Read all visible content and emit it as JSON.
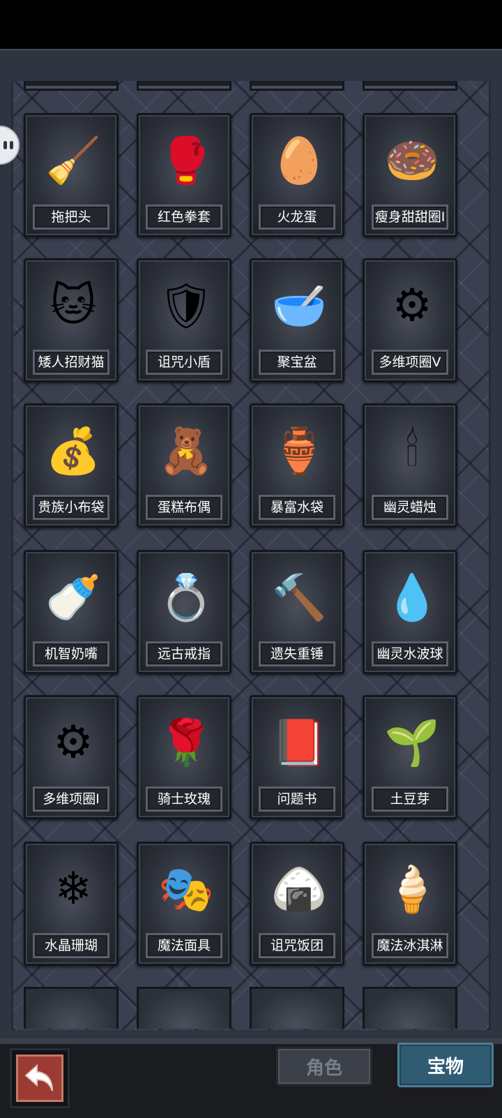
{
  "tabs": [
    {
      "label": "角色",
      "active": false
    },
    {
      "label": "宝物",
      "active": true
    }
  ],
  "items": [
    {
      "name": "拖把头",
      "icon": "mop-head-icon",
      "glyph": "🧹"
    },
    {
      "name": "红色拳套",
      "icon": "red-boxing-glove-icon",
      "glyph": "🥊"
    },
    {
      "name": "火龙蛋",
      "icon": "fire-dragon-egg-icon",
      "glyph": "🥚"
    },
    {
      "name": "瘦身甜甜圈Ⅰ",
      "icon": "donut-icon",
      "glyph": "🍩"
    },
    {
      "name": "矮人招财猫",
      "icon": "lucky-cat-icon",
      "glyph": "🐱"
    },
    {
      "name": "诅咒小盾",
      "icon": "cursed-shield-icon",
      "glyph": "🛡"
    },
    {
      "name": "聚宝盆",
      "icon": "treasure-bowl-icon",
      "glyph": "🥣"
    },
    {
      "name": "多维项圈Ⅴ",
      "icon": "spiked-collar-icon",
      "glyph": "⚙"
    },
    {
      "name": "贵族小布袋",
      "icon": "cloth-pouch-icon",
      "glyph": "💰"
    },
    {
      "name": "蛋糕布偶",
      "icon": "voodoo-doll-icon",
      "glyph": "🧸"
    },
    {
      "name": "暴富水袋",
      "icon": "water-flask-icon",
      "glyph": "🏺"
    },
    {
      "name": "幽灵蜡烛",
      "icon": "ghost-candle-icon",
      "glyph": "🕯"
    },
    {
      "name": "机智奶嘴",
      "icon": "pacifier-icon",
      "glyph": "🍼"
    },
    {
      "name": "远古戒指",
      "icon": "ancient-ring-icon",
      "glyph": "💍"
    },
    {
      "name": "遗失重锤",
      "icon": "lost-hammer-icon",
      "glyph": "🔨"
    },
    {
      "name": "幽灵水波球",
      "icon": "water-orb-icon",
      "glyph": "💧"
    },
    {
      "name": "多维项圈Ⅰ",
      "icon": "spiked-collar-icon",
      "glyph": "⚙"
    },
    {
      "name": "骑士玫瑰",
      "icon": "rose-icon",
      "glyph": "🌹"
    },
    {
      "name": "问题书",
      "icon": "question-book-icon",
      "glyph": "📕"
    },
    {
      "name": "土豆芽",
      "icon": "potato-sprout-icon",
      "glyph": "🌱"
    },
    {
      "name": "水晶珊瑚",
      "icon": "crystal-coral-icon",
      "glyph": "❄"
    },
    {
      "name": "魔法面具",
      "icon": "magic-mask-icon",
      "glyph": "🎭"
    },
    {
      "name": "诅咒饭团",
      "icon": "rice-ball-icon",
      "glyph": "🍙"
    },
    {
      "name": "魔法冰淇淋",
      "icon": "ice-cream-icon",
      "glyph": "🍦"
    }
  ]
}
